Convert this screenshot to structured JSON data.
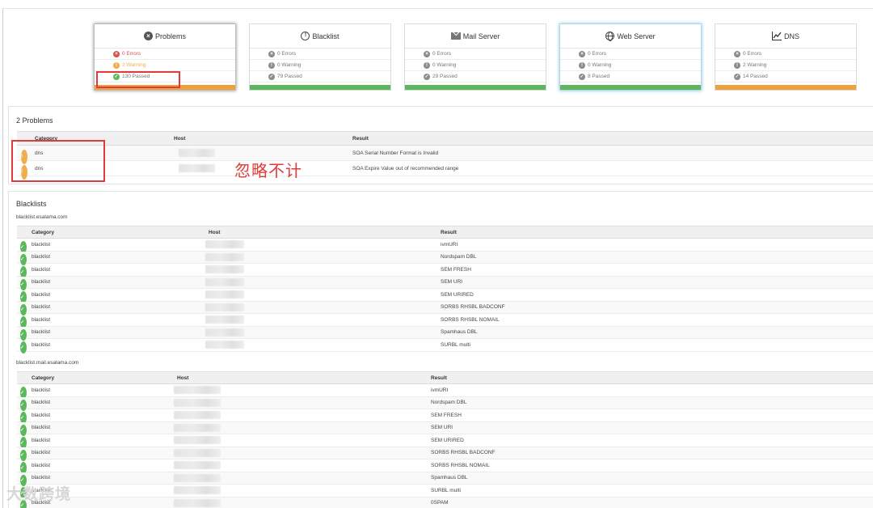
{
  "cards": [
    {
      "key": "problems",
      "title": "Problems",
      "icon": "circle-x-icon",
      "rows": [
        "0 Errors",
        "2 Warning",
        "130 Passed"
      ],
      "bar_color": "#f0a03a"
    },
    {
      "key": "blacklist",
      "title": "Blacklist",
      "icon": "circle-exclamation-icon",
      "rows": [
        "0 Errors",
        "0 Warning",
        "79 Passed"
      ],
      "bar_color": "#5cb85c"
    },
    {
      "key": "mail",
      "title": "Mail Server",
      "icon": "envelope-icon",
      "rows": [
        "0 Errors",
        "0 Warning",
        "29 Passed"
      ],
      "bar_color": "#5cb85c"
    },
    {
      "key": "web",
      "title": "Web Server",
      "icon": "globe-icon",
      "rows": [
        "0 Errors",
        "0 Warning",
        "8 Passed"
      ],
      "bar_color": "#5cb85c"
    },
    {
      "key": "dns",
      "title": "DNS",
      "icon": "chart-icon",
      "rows": [
        "0 Errors",
        "2 Warning",
        "14 Passed"
      ],
      "bar_color": "#f0a03a"
    }
  ],
  "problems": {
    "title": "2 Problems",
    "headers": [
      "Category",
      "Host",
      "Result"
    ],
    "rows": [
      {
        "category": "dns",
        "result": "SOA Serial Number Format is Invalid"
      },
      {
        "category": "dns",
        "result": "SOA Expire Value out of recommended range"
      }
    ]
  },
  "annotation": "忽略不计",
  "blacklists": {
    "title": "Blacklists",
    "groups": [
      {
        "name": "blacklist.esalama.com",
        "headers": [
          "Category",
          "Host",
          "Result"
        ],
        "rows": [
          {
            "category": "blacklist",
            "result": "ivmURI"
          },
          {
            "category": "blacklist",
            "result": "Nordspam DBL"
          },
          {
            "category": "blacklist",
            "result": "SEM FRESH"
          },
          {
            "category": "blacklist",
            "result": "SEM URI"
          },
          {
            "category": "blacklist",
            "result": "SEM URIRED"
          },
          {
            "category": "blacklist",
            "result": "SORBS RHSBL BADCONF"
          },
          {
            "category": "blacklist",
            "result": "SORBS RHSBL NOMAIL"
          },
          {
            "category": "blacklist",
            "result": "Spamhaus DBL"
          },
          {
            "category": "blacklist",
            "result": "SURBL multi"
          }
        ]
      },
      {
        "name": "blacklist.mail.esalama.com",
        "headers": [
          "Category",
          "Host",
          "Result"
        ],
        "rows": [
          {
            "category": "blacklist",
            "result": "ivmURI"
          },
          {
            "category": "blacklist",
            "result": "Nordspam DBL"
          },
          {
            "category": "blacklist",
            "result": "SEM FRESH"
          },
          {
            "category": "blacklist",
            "result": "SEM URI"
          },
          {
            "category": "blacklist",
            "result": "SEM URIRED"
          },
          {
            "category": "blacklist",
            "result": "SORBS RHSBL BADCONF"
          },
          {
            "category": "blacklist",
            "result": "SORBS RHSBL NOMAIL"
          },
          {
            "category": "blacklist",
            "result": "Spamhaus DBL"
          },
          {
            "category": "blacklist",
            "result": "SURBL multi"
          },
          {
            "category": "blacklist",
            "result": "0SPAM"
          }
        ]
      }
    ]
  },
  "watermark": "大数跨境"
}
